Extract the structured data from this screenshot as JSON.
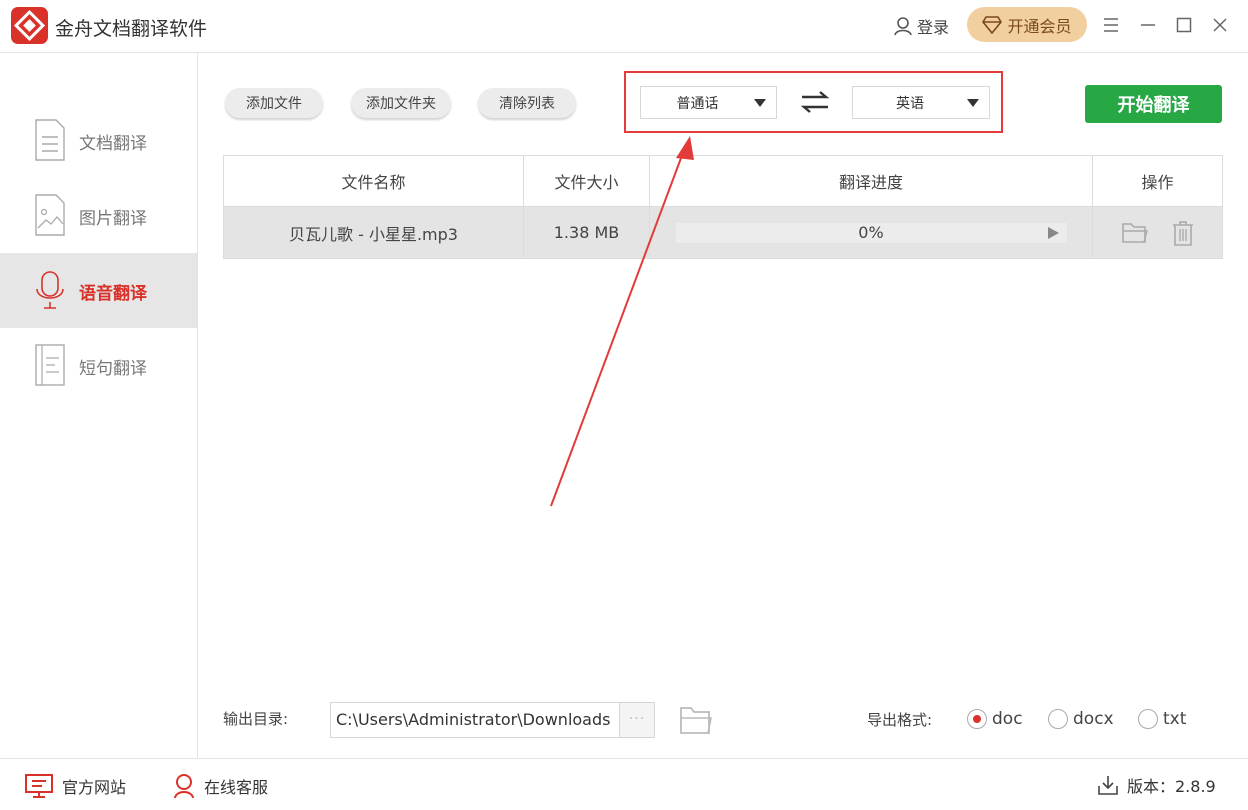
{
  "app": {
    "title": "金舟文档翻译软件",
    "login_label": "登录",
    "vip_label": "开通会员",
    "brand_color": "#d8322a",
    "accent_green": "#28a745"
  },
  "sidebar": {
    "items": [
      {
        "label": "文档翻译",
        "icon": "document-icon",
        "active": false
      },
      {
        "label": "图片翻译",
        "icon": "image-icon",
        "active": false
      },
      {
        "label": "语音翻译",
        "icon": "microphone-icon",
        "active": true
      },
      {
        "label": "短句翻译",
        "icon": "text-lines-icon",
        "active": false
      }
    ]
  },
  "toolbar": {
    "add_file": "添加文件",
    "add_folder": "添加文件夹",
    "clear_list": "清除列表",
    "source_lang": "普通话",
    "target_lang": "英语",
    "start": "开始翻译"
  },
  "table": {
    "headers": [
      "文件名称",
      "文件大小",
      "翻译进度",
      "操作"
    ],
    "rows": [
      {
        "name": "贝瓦儿歌 - 小星星.mp3",
        "size": "1.38 MB",
        "progress_text": "0%",
        "progress": 0
      }
    ]
  },
  "output": {
    "label": "输出目录:",
    "path": "C:\\Users\\Administrator\\Downloads",
    "more": "···",
    "format_label": "导出格式:",
    "formats": [
      {
        "label": "doc",
        "selected": true
      },
      {
        "label": "docx",
        "selected": false
      },
      {
        "label": "txt",
        "selected": false
      }
    ]
  },
  "footer": {
    "website": "官方网站",
    "support": "在线客服",
    "version": "版本：2.8.9"
  }
}
